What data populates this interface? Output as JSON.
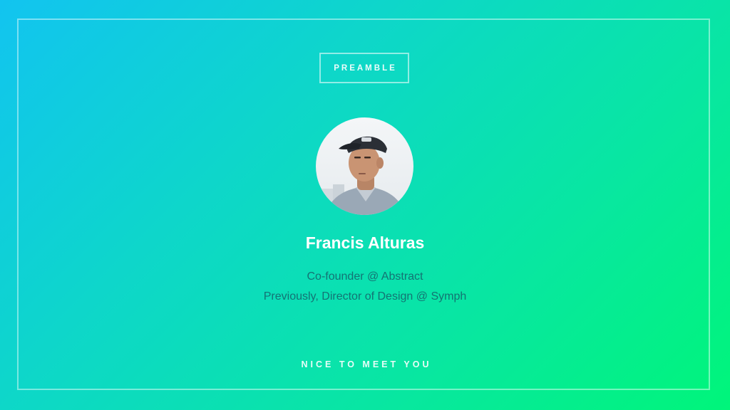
{
  "slide": {
    "section_label": "PREAMBLE",
    "speaker": {
      "name": "Francis Alturas",
      "roles": [
        "Co-founder @ Abstract",
        "Previously, Director of Design @ Symph"
      ]
    },
    "footer_text": "NICE TO MEET YOU"
  },
  "colors": {
    "gradient_start": "#12c4f0",
    "gradient_end": "#00f57a",
    "name_text": "#ffffff",
    "role_text": "#1f6670"
  },
  "icons": {
    "avatar": "speaker-photo"
  }
}
